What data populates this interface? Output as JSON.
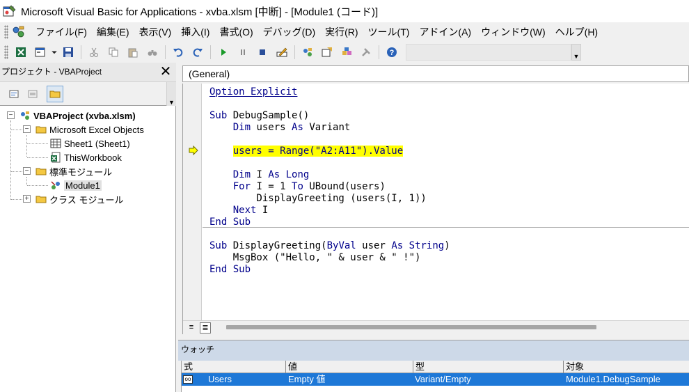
{
  "window": {
    "title": "Microsoft Visual Basic for Applications - xvba.xlsm [中断] - [Module1 (コード)]"
  },
  "menubar": {
    "items": [
      "ファイル(F)",
      "編集(E)",
      "表示(V)",
      "挿入(I)",
      "書式(O)",
      "デバッグ(D)",
      "実行(R)",
      "ツール(T)",
      "アドイン(A)",
      "ウィンドウ(W)",
      "ヘルプ(H)"
    ]
  },
  "toolbar": {
    "buttons": [
      "view-excel",
      "insert-module",
      "save",
      "cut",
      "copy",
      "paste",
      "find",
      "undo",
      "redo",
      "run",
      "break",
      "reset",
      "design-mode",
      "project-explorer",
      "properties",
      "object-browser",
      "toolbox",
      "help"
    ]
  },
  "project": {
    "title": "プロジェクト - VBAProject",
    "close": "✕",
    "tree": {
      "root": "VBAProject (xvba.xlsm)",
      "excel_objects": "Microsoft Excel Objects",
      "sheet1": "Sheet1 (Sheet1)",
      "thisworkbook": "ThisWorkbook",
      "std_modules": "標準モジュール",
      "module1": "Module1",
      "class_modules": "クラス モジュール"
    }
  },
  "code": {
    "combo": "(General)",
    "line_option": "Option Explicit",
    "sub1_decl_kw": "Sub",
    "sub1_decl_rest": " DebugSample()",
    "dim_users_kw1": "    Dim",
    "dim_users_mid": " users ",
    "dim_users_kw2": "As",
    "dim_users_rest": " Variant",
    "current_line": "users = Range(\"A2:A11\").Value",
    "dim_i_kw1": "    Dim",
    "dim_i_mid": " I ",
    "dim_i_kw2": "As Long",
    "for_kw1": "    For",
    "for_mid": " I = 1 ",
    "for_kw2": "To",
    "for_rest": " UBound(users)",
    "call_line": "        DisplayGreeting (users(I, 1))",
    "next_kw": "    Next",
    "next_rest": " I",
    "end_sub1": "End Sub",
    "sub2_kw1": "Sub",
    "sub2_mid": " DisplayGreeting(",
    "sub2_kw2": "ByVal",
    "sub2_mid2": " user ",
    "sub2_kw3": "As String",
    "sub2_rest": ")",
    "msgbox_line": "    MsgBox (\"Hello, \" & user & \" !\")",
    "end_sub2": "End Sub"
  },
  "watch": {
    "title": "ウォッチ",
    "headers": [
      "式",
      "値",
      "型",
      "対象"
    ],
    "row": {
      "expression": "Users",
      "value": "Empty 値",
      "type": "Variant/Empty",
      "context": "Module1.DebugSample"
    }
  },
  "colors": {
    "keyword": "#00008b",
    "highlight": "#ffff00",
    "selection": "#1e78d7",
    "watch_title_bg": "#cdd9e8"
  }
}
